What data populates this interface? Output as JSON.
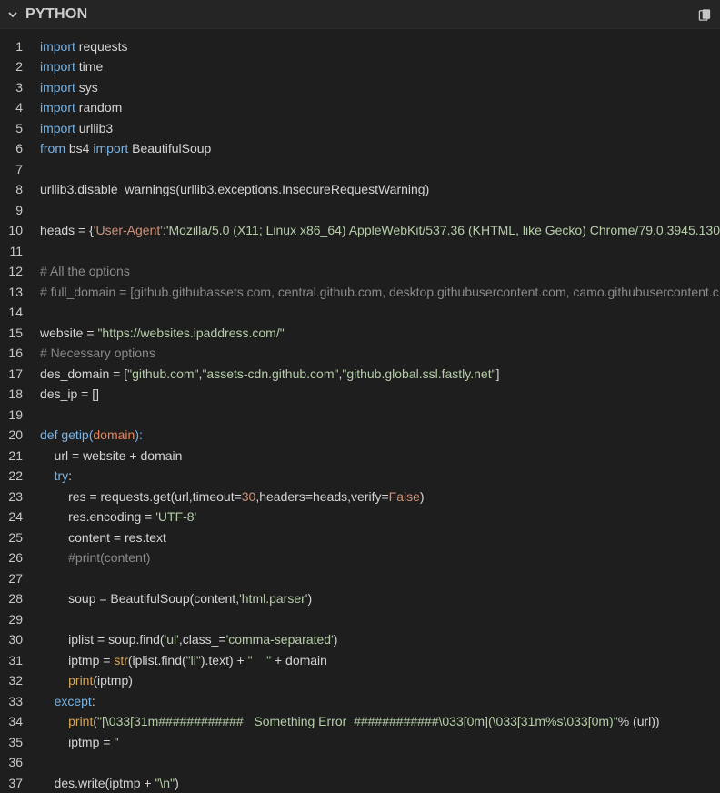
{
  "panel": {
    "title": "PYTHON",
    "copy_icon": "clipboard-icon",
    "collapse_icon": "chevron-down-icon"
  },
  "lines": [
    {
      "n": "1",
      "tokens": [
        {
          "t": "import",
          "c": "kw"
        },
        {
          "t": " requests",
          "c": ""
        }
      ]
    },
    {
      "n": "2",
      "tokens": [
        {
          "t": "import",
          "c": "kw"
        },
        {
          "t": " time",
          "c": ""
        }
      ]
    },
    {
      "n": "3",
      "tokens": [
        {
          "t": "import",
          "c": "kw"
        },
        {
          "t": " sys",
          "c": ""
        }
      ]
    },
    {
      "n": "4",
      "tokens": [
        {
          "t": "import",
          "c": "kw"
        },
        {
          "t": " random",
          "c": ""
        }
      ]
    },
    {
      "n": "5",
      "tokens": [
        {
          "t": "import",
          "c": "kw"
        },
        {
          "t": " urllib3",
          "c": ""
        }
      ]
    },
    {
      "n": "6",
      "tokens": [
        {
          "t": "from",
          "c": "kw"
        },
        {
          "t": " bs4 ",
          "c": ""
        },
        {
          "t": "import",
          "c": "kw"
        },
        {
          "t": " BeautifulSoup",
          "c": ""
        }
      ]
    },
    {
      "n": "7",
      "tokens": []
    },
    {
      "n": "8",
      "tokens": [
        {
          "t": "urllib3.disable_warnings(urllib3.exceptions.InsecureRequestWarning)",
          "c": ""
        }
      ]
    },
    {
      "n": "9",
      "tokens": []
    },
    {
      "n": "10",
      "tokens": [
        {
          "t": "heads = {",
          "c": ""
        },
        {
          "t": "'User-Agent'",
          "c": "str"
        },
        {
          "t": ":",
          "c": ""
        },
        {
          "t": "'Mozilla/5.0 (X11; Linux x86_64) AppleWebKit/537.36 (KHTML, like Gecko) Chrome/79.0.3945.130",
          "c": "grn"
        }
      ]
    },
    {
      "n": "11",
      "tokens": []
    },
    {
      "n": "12",
      "tokens": [
        {
          "t": "# All the options",
          "c": "com"
        }
      ]
    },
    {
      "n": "13",
      "tokens": [
        {
          "t": "# full_domain = [github.githubassets.com, central.github.com, desktop.githubusercontent.com, camo.githubusercontent.c",
          "c": "com"
        }
      ]
    },
    {
      "n": "14",
      "tokens": []
    },
    {
      "n": "15",
      "tokens": [
        {
          "t": "website = ",
          "c": ""
        },
        {
          "t": "\"https://websites.ipaddress.com/\"",
          "c": "grn"
        }
      ]
    },
    {
      "n": "16",
      "tokens": [
        {
          "t": "# Necessary options",
          "c": "com"
        }
      ]
    },
    {
      "n": "17",
      "tokens": [
        {
          "t": "des_domain = [",
          "c": ""
        },
        {
          "t": "\"github.com\"",
          "c": "grn"
        },
        {
          "t": ",",
          "c": ""
        },
        {
          "t": "\"assets-cdn.github.com\"",
          "c": "grn"
        },
        {
          "t": ",",
          "c": ""
        },
        {
          "t": "\"github.global.ssl.fastly.net\"",
          "c": "grn"
        },
        {
          "t": "]",
          "c": ""
        }
      ]
    },
    {
      "n": "18",
      "tokens": [
        {
          "t": "des_ip = []",
          "c": ""
        }
      ]
    },
    {
      "n": "19",
      "tokens": []
    },
    {
      "n": "20",
      "tokens": [
        {
          "t": "def",
          "c": "kw"
        },
        {
          "t": " ",
          "c": ""
        },
        {
          "t": "getip",
          "c": "kw"
        },
        {
          "t": "(",
          "c": "kw"
        },
        {
          "t": "domain",
          "c": "param"
        },
        {
          "t": "):",
          "c": "kw"
        }
      ]
    },
    {
      "n": "21",
      "tokens": [
        {
          "t": "    url = website + domain",
          "c": ""
        }
      ]
    },
    {
      "n": "22",
      "tokens": [
        {
          "t": "    ",
          "c": ""
        },
        {
          "t": "try",
          "c": "kw"
        },
        {
          "t": ":",
          "c": ""
        }
      ]
    },
    {
      "n": "23",
      "tokens": [
        {
          "t": "        res = requests.get(url,timeout=",
          "c": ""
        },
        {
          "t": "30",
          "c": "num"
        },
        {
          "t": ",headers=heads,verify=",
          "c": ""
        },
        {
          "t": "False",
          "c": "num"
        },
        {
          "t": ")",
          "c": ""
        }
      ]
    },
    {
      "n": "24",
      "tokens": [
        {
          "t": "        res.encoding = ",
          "c": ""
        },
        {
          "t": "'UTF-8'",
          "c": "grn"
        }
      ]
    },
    {
      "n": "25",
      "tokens": [
        {
          "t": "        content = res.text",
          "c": ""
        }
      ]
    },
    {
      "n": "26",
      "tokens": [
        {
          "t": "        #print(content)",
          "c": "com"
        }
      ]
    },
    {
      "n": "27",
      "tokens": []
    },
    {
      "n": "28",
      "tokens": [
        {
          "t": "        soup = BeautifulSoup(content,",
          "c": ""
        },
        {
          "t": "'html.parser'",
          "c": "grn"
        },
        {
          "t": ")",
          "c": ""
        }
      ]
    },
    {
      "n": "29",
      "tokens": []
    },
    {
      "n": "30",
      "tokens": [
        {
          "t": "        iplist = soup.find(",
          "c": ""
        },
        {
          "t": "'ul'",
          "c": "grn"
        },
        {
          "t": ",class_=",
          "c": ""
        },
        {
          "t": "'comma-separated'",
          "c": "grn"
        },
        {
          "t": ")",
          "c": ""
        }
      ]
    },
    {
      "n": "31",
      "tokens": [
        {
          "t": "        iptmp = ",
          "c": ""
        },
        {
          "t": "str",
          "c": "fn"
        },
        {
          "t": "(iplist.find(",
          "c": ""
        },
        {
          "t": "\"li\"",
          "c": "grn"
        },
        {
          "t": ").text) + ",
          "c": ""
        },
        {
          "t": "\"    \"",
          "c": "grn"
        },
        {
          "t": " + domain",
          "c": ""
        }
      ]
    },
    {
      "n": "32",
      "tokens": [
        {
          "t": "        ",
          "c": ""
        },
        {
          "t": "print",
          "c": "fn"
        },
        {
          "t": "(iptmp)",
          "c": ""
        }
      ]
    },
    {
      "n": "33",
      "tokens": [
        {
          "t": "    ",
          "c": ""
        },
        {
          "t": "except",
          "c": "kw"
        },
        {
          "t": ":",
          "c": ""
        }
      ]
    },
    {
      "n": "34",
      "tokens": [
        {
          "t": "        ",
          "c": ""
        },
        {
          "t": "print",
          "c": "fn"
        },
        {
          "t": "(",
          "c": ""
        },
        {
          "t": "\"[\\033[31m############   Something Error  ############\\033[0m](\\033[31m%s\\033[0m)\"",
          "c": "grn"
        },
        {
          "t": "% (url))",
          "c": ""
        }
      ]
    },
    {
      "n": "35",
      "tokens": [
        {
          "t": "        iptmp = ",
          "c": ""
        },
        {
          "t": "''",
          "c": "grn"
        }
      ]
    },
    {
      "n": "36",
      "tokens": []
    },
    {
      "n": "37",
      "tokens": [
        {
          "t": "    des.write(iptmp + ",
          "c": ""
        },
        {
          "t": "\"\\n\"",
          "c": "grn"
        },
        {
          "t": ")",
          "c": ""
        }
      ]
    }
  ]
}
